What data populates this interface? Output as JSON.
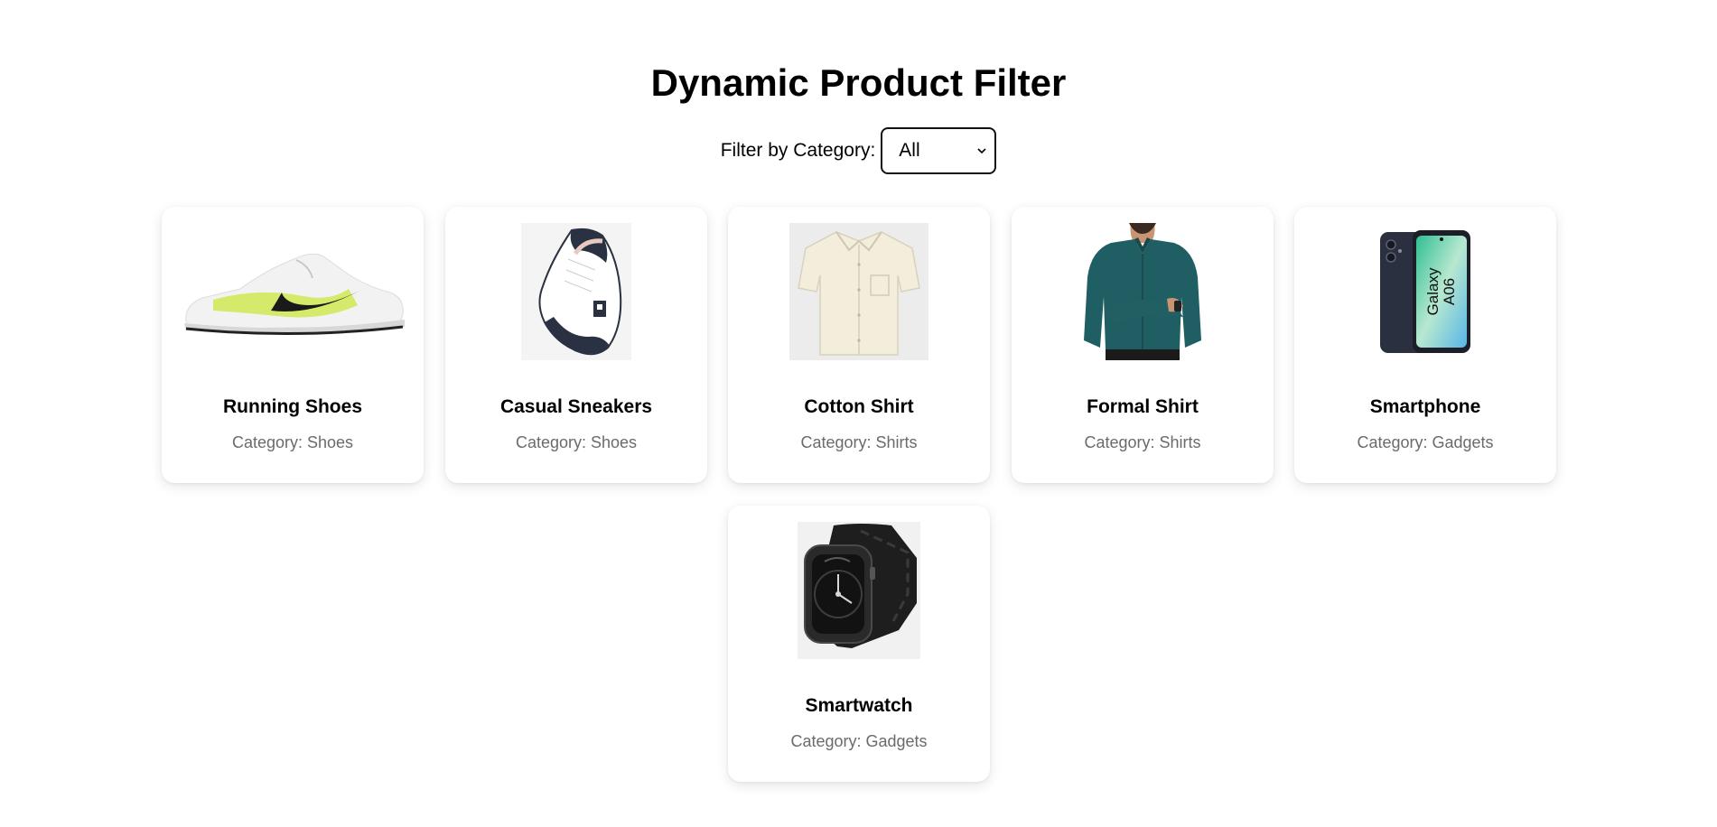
{
  "header": {
    "title": "Dynamic Product Filter"
  },
  "filter": {
    "label": "Filter by Category:",
    "selected": "All"
  },
  "products": [
    {
      "name": "Running Shoes",
      "category": "Category: Shoes",
      "icon": "running-shoe-image"
    },
    {
      "name": "Casual Sneakers",
      "category": "Category: Shoes",
      "icon": "sneaker-image"
    },
    {
      "name": "Cotton Shirt",
      "category": "Category: Shirts",
      "icon": "cotton-shirt-image"
    },
    {
      "name": "Formal Shirt",
      "category": "Category: Shirts",
      "icon": "formal-shirt-image"
    },
    {
      "name": "Smartphone",
      "category": "Category: Gadgets",
      "icon": "smartphone-image",
      "image_text": "Galaxy A06"
    },
    {
      "name": "Smartwatch",
      "category": "Category: Gadgets",
      "icon": "smartwatch-image"
    }
  ]
}
